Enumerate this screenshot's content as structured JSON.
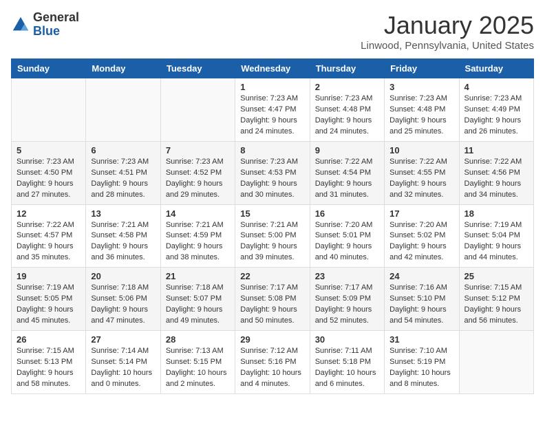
{
  "logo": {
    "general": "General",
    "blue": "Blue"
  },
  "title": "January 2025",
  "location": "Linwood, Pennsylvania, United States",
  "weekdays": [
    "Sunday",
    "Monday",
    "Tuesday",
    "Wednesday",
    "Thursday",
    "Friday",
    "Saturday"
  ],
  "weeks": [
    [
      {
        "day": "",
        "info": ""
      },
      {
        "day": "",
        "info": ""
      },
      {
        "day": "",
        "info": ""
      },
      {
        "day": "1",
        "info": "Sunrise: 7:23 AM\nSunset: 4:47 PM\nDaylight: 9 hours\nand 24 minutes."
      },
      {
        "day": "2",
        "info": "Sunrise: 7:23 AM\nSunset: 4:48 PM\nDaylight: 9 hours\nand 24 minutes."
      },
      {
        "day": "3",
        "info": "Sunrise: 7:23 AM\nSunset: 4:48 PM\nDaylight: 9 hours\nand 25 minutes."
      },
      {
        "day": "4",
        "info": "Sunrise: 7:23 AM\nSunset: 4:49 PM\nDaylight: 9 hours\nand 26 minutes."
      }
    ],
    [
      {
        "day": "5",
        "info": "Sunrise: 7:23 AM\nSunset: 4:50 PM\nDaylight: 9 hours\nand 27 minutes."
      },
      {
        "day": "6",
        "info": "Sunrise: 7:23 AM\nSunset: 4:51 PM\nDaylight: 9 hours\nand 28 minutes."
      },
      {
        "day": "7",
        "info": "Sunrise: 7:23 AM\nSunset: 4:52 PM\nDaylight: 9 hours\nand 29 minutes."
      },
      {
        "day": "8",
        "info": "Sunrise: 7:23 AM\nSunset: 4:53 PM\nDaylight: 9 hours\nand 30 minutes."
      },
      {
        "day": "9",
        "info": "Sunrise: 7:22 AM\nSunset: 4:54 PM\nDaylight: 9 hours\nand 31 minutes."
      },
      {
        "day": "10",
        "info": "Sunrise: 7:22 AM\nSunset: 4:55 PM\nDaylight: 9 hours\nand 32 minutes."
      },
      {
        "day": "11",
        "info": "Sunrise: 7:22 AM\nSunset: 4:56 PM\nDaylight: 9 hours\nand 34 minutes."
      }
    ],
    [
      {
        "day": "12",
        "info": "Sunrise: 7:22 AM\nSunset: 4:57 PM\nDaylight: 9 hours\nand 35 minutes."
      },
      {
        "day": "13",
        "info": "Sunrise: 7:21 AM\nSunset: 4:58 PM\nDaylight: 9 hours\nand 36 minutes."
      },
      {
        "day": "14",
        "info": "Sunrise: 7:21 AM\nSunset: 4:59 PM\nDaylight: 9 hours\nand 38 minutes."
      },
      {
        "day": "15",
        "info": "Sunrise: 7:21 AM\nSunset: 5:00 PM\nDaylight: 9 hours\nand 39 minutes."
      },
      {
        "day": "16",
        "info": "Sunrise: 7:20 AM\nSunset: 5:01 PM\nDaylight: 9 hours\nand 40 minutes."
      },
      {
        "day": "17",
        "info": "Sunrise: 7:20 AM\nSunset: 5:02 PM\nDaylight: 9 hours\nand 42 minutes."
      },
      {
        "day": "18",
        "info": "Sunrise: 7:19 AM\nSunset: 5:04 PM\nDaylight: 9 hours\nand 44 minutes."
      }
    ],
    [
      {
        "day": "19",
        "info": "Sunrise: 7:19 AM\nSunset: 5:05 PM\nDaylight: 9 hours\nand 45 minutes."
      },
      {
        "day": "20",
        "info": "Sunrise: 7:18 AM\nSunset: 5:06 PM\nDaylight: 9 hours\nand 47 minutes."
      },
      {
        "day": "21",
        "info": "Sunrise: 7:18 AM\nSunset: 5:07 PM\nDaylight: 9 hours\nand 49 minutes."
      },
      {
        "day": "22",
        "info": "Sunrise: 7:17 AM\nSunset: 5:08 PM\nDaylight: 9 hours\nand 50 minutes."
      },
      {
        "day": "23",
        "info": "Sunrise: 7:17 AM\nSunset: 5:09 PM\nDaylight: 9 hours\nand 52 minutes."
      },
      {
        "day": "24",
        "info": "Sunrise: 7:16 AM\nSunset: 5:10 PM\nDaylight: 9 hours\nand 54 minutes."
      },
      {
        "day": "25",
        "info": "Sunrise: 7:15 AM\nSunset: 5:12 PM\nDaylight: 9 hours\nand 56 minutes."
      }
    ],
    [
      {
        "day": "26",
        "info": "Sunrise: 7:15 AM\nSunset: 5:13 PM\nDaylight: 9 hours\nand 58 minutes."
      },
      {
        "day": "27",
        "info": "Sunrise: 7:14 AM\nSunset: 5:14 PM\nDaylight: 10 hours\nand 0 minutes."
      },
      {
        "day": "28",
        "info": "Sunrise: 7:13 AM\nSunset: 5:15 PM\nDaylight: 10 hours\nand 2 minutes."
      },
      {
        "day": "29",
        "info": "Sunrise: 7:12 AM\nSunset: 5:16 PM\nDaylight: 10 hours\nand 4 minutes."
      },
      {
        "day": "30",
        "info": "Sunrise: 7:11 AM\nSunset: 5:18 PM\nDaylight: 10 hours\nand 6 minutes."
      },
      {
        "day": "31",
        "info": "Sunrise: 7:10 AM\nSunset: 5:19 PM\nDaylight: 10 hours\nand 8 minutes."
      },
      {
        "day": "",
        "info": ""
      }
    ]
  ]
}
